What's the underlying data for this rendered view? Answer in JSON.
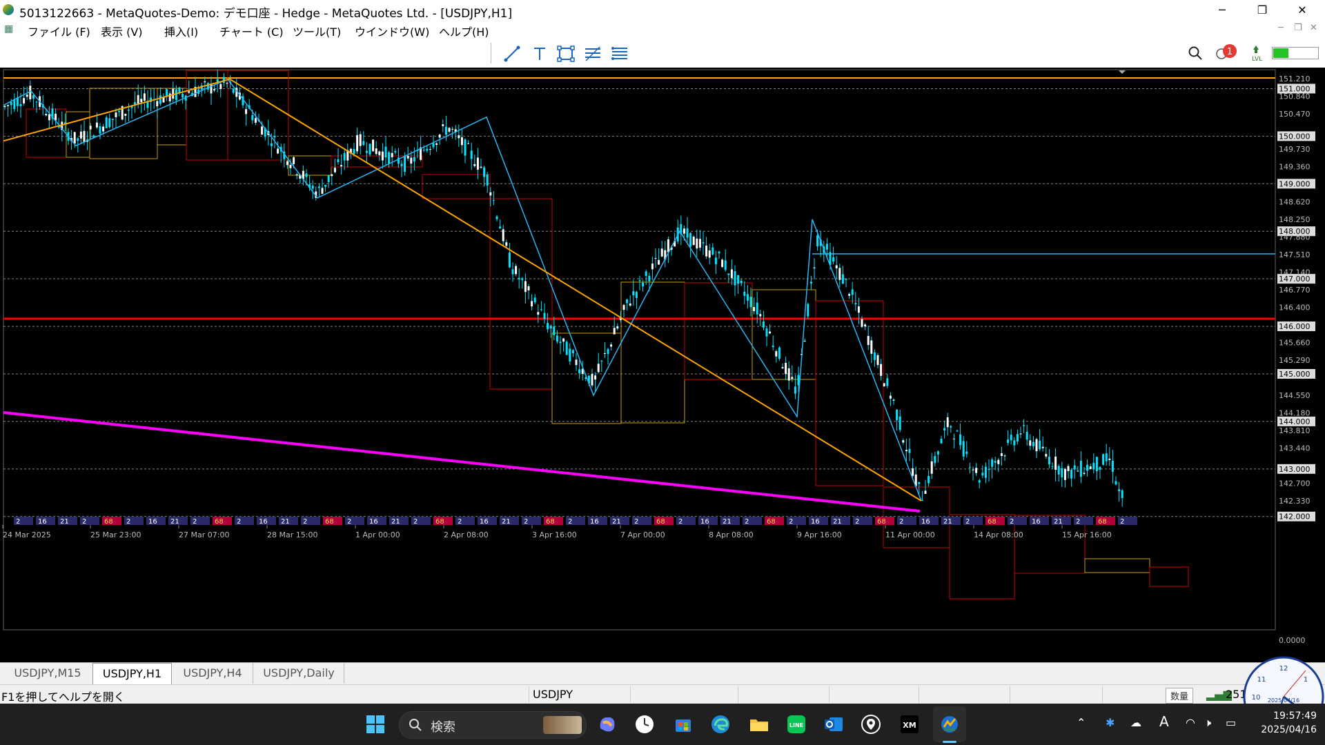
{
  "window": {
    "title": "5013122663 - MetaQuotes-Demo: デモ口座 - Hedge - MetaQuotes Ltd. - [USDJPY,H1]",
    "minimize": "─",
    "restore": "❐",
    "close": "✕"
  },
  "menu": {
    "items": [
      "ファイル (F)",
      "表示 (V)",
      "挿入(I)",
      "チャート (C)",
      "ツール(T)",
      "ウインドウ(W)",
      "ヘルプ(H)"
    ],
    "mdi": [
      "─",
      "❐",
      "✕"
    ]
  },
  "toolbar": {
    "tools": [
      "trendline-icon",
      "text-icon",
      "rectangle-icon",
      "fibonacci-icon",
      "gann-icon"
    ],
    "notification_count": "1",
    "lvl_label": "LVL"
  },
  "chart": {
    "symbol": "USDJPY",
    "timeframe": "H1",
    "price_labels": [
      "151.210",
      "150.840",
      "150.470",
      "149.730",
      "149.360",
      "148.620",
      "148.250",
      "147.880",
      "147.510",
      "147.140",
      "146.770",
      "146.400",
      "145.660",
      "145.290",
      "144.550",
      "144.180",
      "143.810",
      "143.440",
      "142.700",
      "142.330",
      "0.0000"
    ],
    "highlighted_price_labels": [
      "151.000",
      "150.000",
      "149.000",
      "148.000",
      "147.000",
      "146.000",
      "145.000",
      "144.000",
      "143.000",
      "142.000"
    ],
    "date_labels": [
      "24 Mar 2025",
      "25 Mar 23:00",
      "27 Mar 07:00",
      "28 Mar 15:00",
      "1 Apr 00:00",
      "2 Apr 08:00",
      "3 Apr 16:00",
      "7 Apr 00:00",
      "8 Apr 08:00",
      "9 Apr 16:00",
      "11 Apr 00:00",
      "14 Apr 08:00",
      "15 Apr 16:00"
    ],
    "session_markers": [
      "2",
      "16",
      "21",
      "2",
      "68"
    ],
    "colors": {
      "candle": "#00e5ff",
      "zigzag": "#29b6f6",
      "trendline_orange": "#ffa500",
      "resistance_red": "#ff0000",
      "support_magenta": "#ff00ff",
      "level_cyan": "#29b6f6",
      "box_red": "#cc0000",
      "box_yellow": "#c8a000"
    }
  },
  "tabs": [
    {
      "label": "USDJPY,M15",
      "active": false
    },
    {
      "label": "USDJPY,H1",
      "active": true
    },
    {
      "label": "USDJPY,H4",
      "active": false
    },
    {
      "label": "USDJPY,Daily",
      "active": false
    }
  ],
  "status": {
    "help": "F1を押してヘルプを開く",
    "symbol": "USDJPY",
    "volume_label": "数量",
    "signal": "251"
  },
  "clock": {
    "date": "2025/04/16"
  },
  "taskbar": {
    "search_label": "検索",
    "time": "19:57:49",
    "date": "2025/04/16"
  }
}
